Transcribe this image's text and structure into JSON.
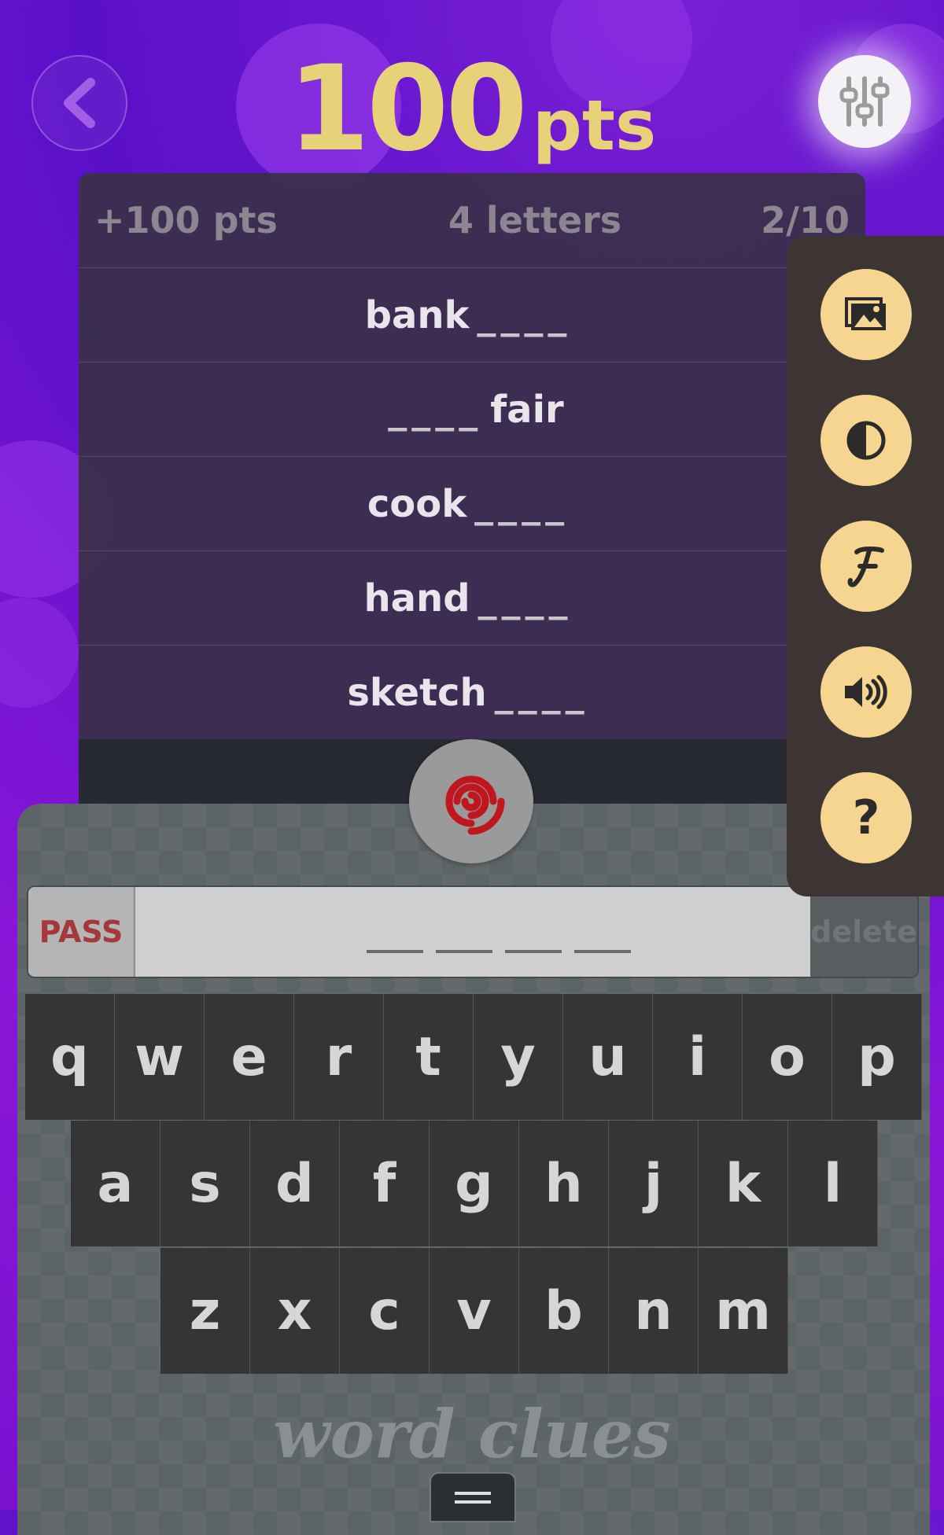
{
  "header": {
    "score_value": "100",
    "score_unit": "pts"
  },
  "clue_panel": {
    "bonus": "+100 pts",
    "length": "4 letters",
    "progress": "2/10",
    "clues": [
      {
        "before": "bank",
        "after": "",
        "blank": "____"
      },
      {
        "before": "",
        "after": "fair",
        "blank": "____"
      },
      {
        "before": "cook",
        "after": "",
        "blank": "____"
      },
      {
        "before": "hand",
        "after": "",
        "blank": "____"
      },
      {
        "before": "sketch",
        "after": "",
        "blank": "____"
      }
    ]
  },
  "side_menu": {
    "icons": [
      "image-icon",
      "contrast-icon",
      "font-icon",
      "volume-icon",
      "help-icon"
    ],
    "help_label": "?"
  },
  "answer_bar": {
    "pass_label": "PASS",
    "delete_label": "delete",
    "slot_count": 4
  },
  "keyboard": {
    "row1": [
      "q",
      "w",
      "e",
      "r",
      "t",
      "y",
      "u",
      "i",
      "o",
      "p"
    ],
    "row2": [
      "a",
      "s",
      "d",
      "f",
      "g",
      "h",
      "j",
      "k",
      "l"
    ],
    "row3": [
      "z",
      "x",
      "c",
      "v",
      "b",
      "n",
      "m"
    ]
  },
  "app_name": "word clues",
  "colors": {
    "score": "#e7d27a",
    "side_button": "#f5d58f",
    "pass_text": "#a5383c",
    "spiral": "#c0161e"
  }
}
